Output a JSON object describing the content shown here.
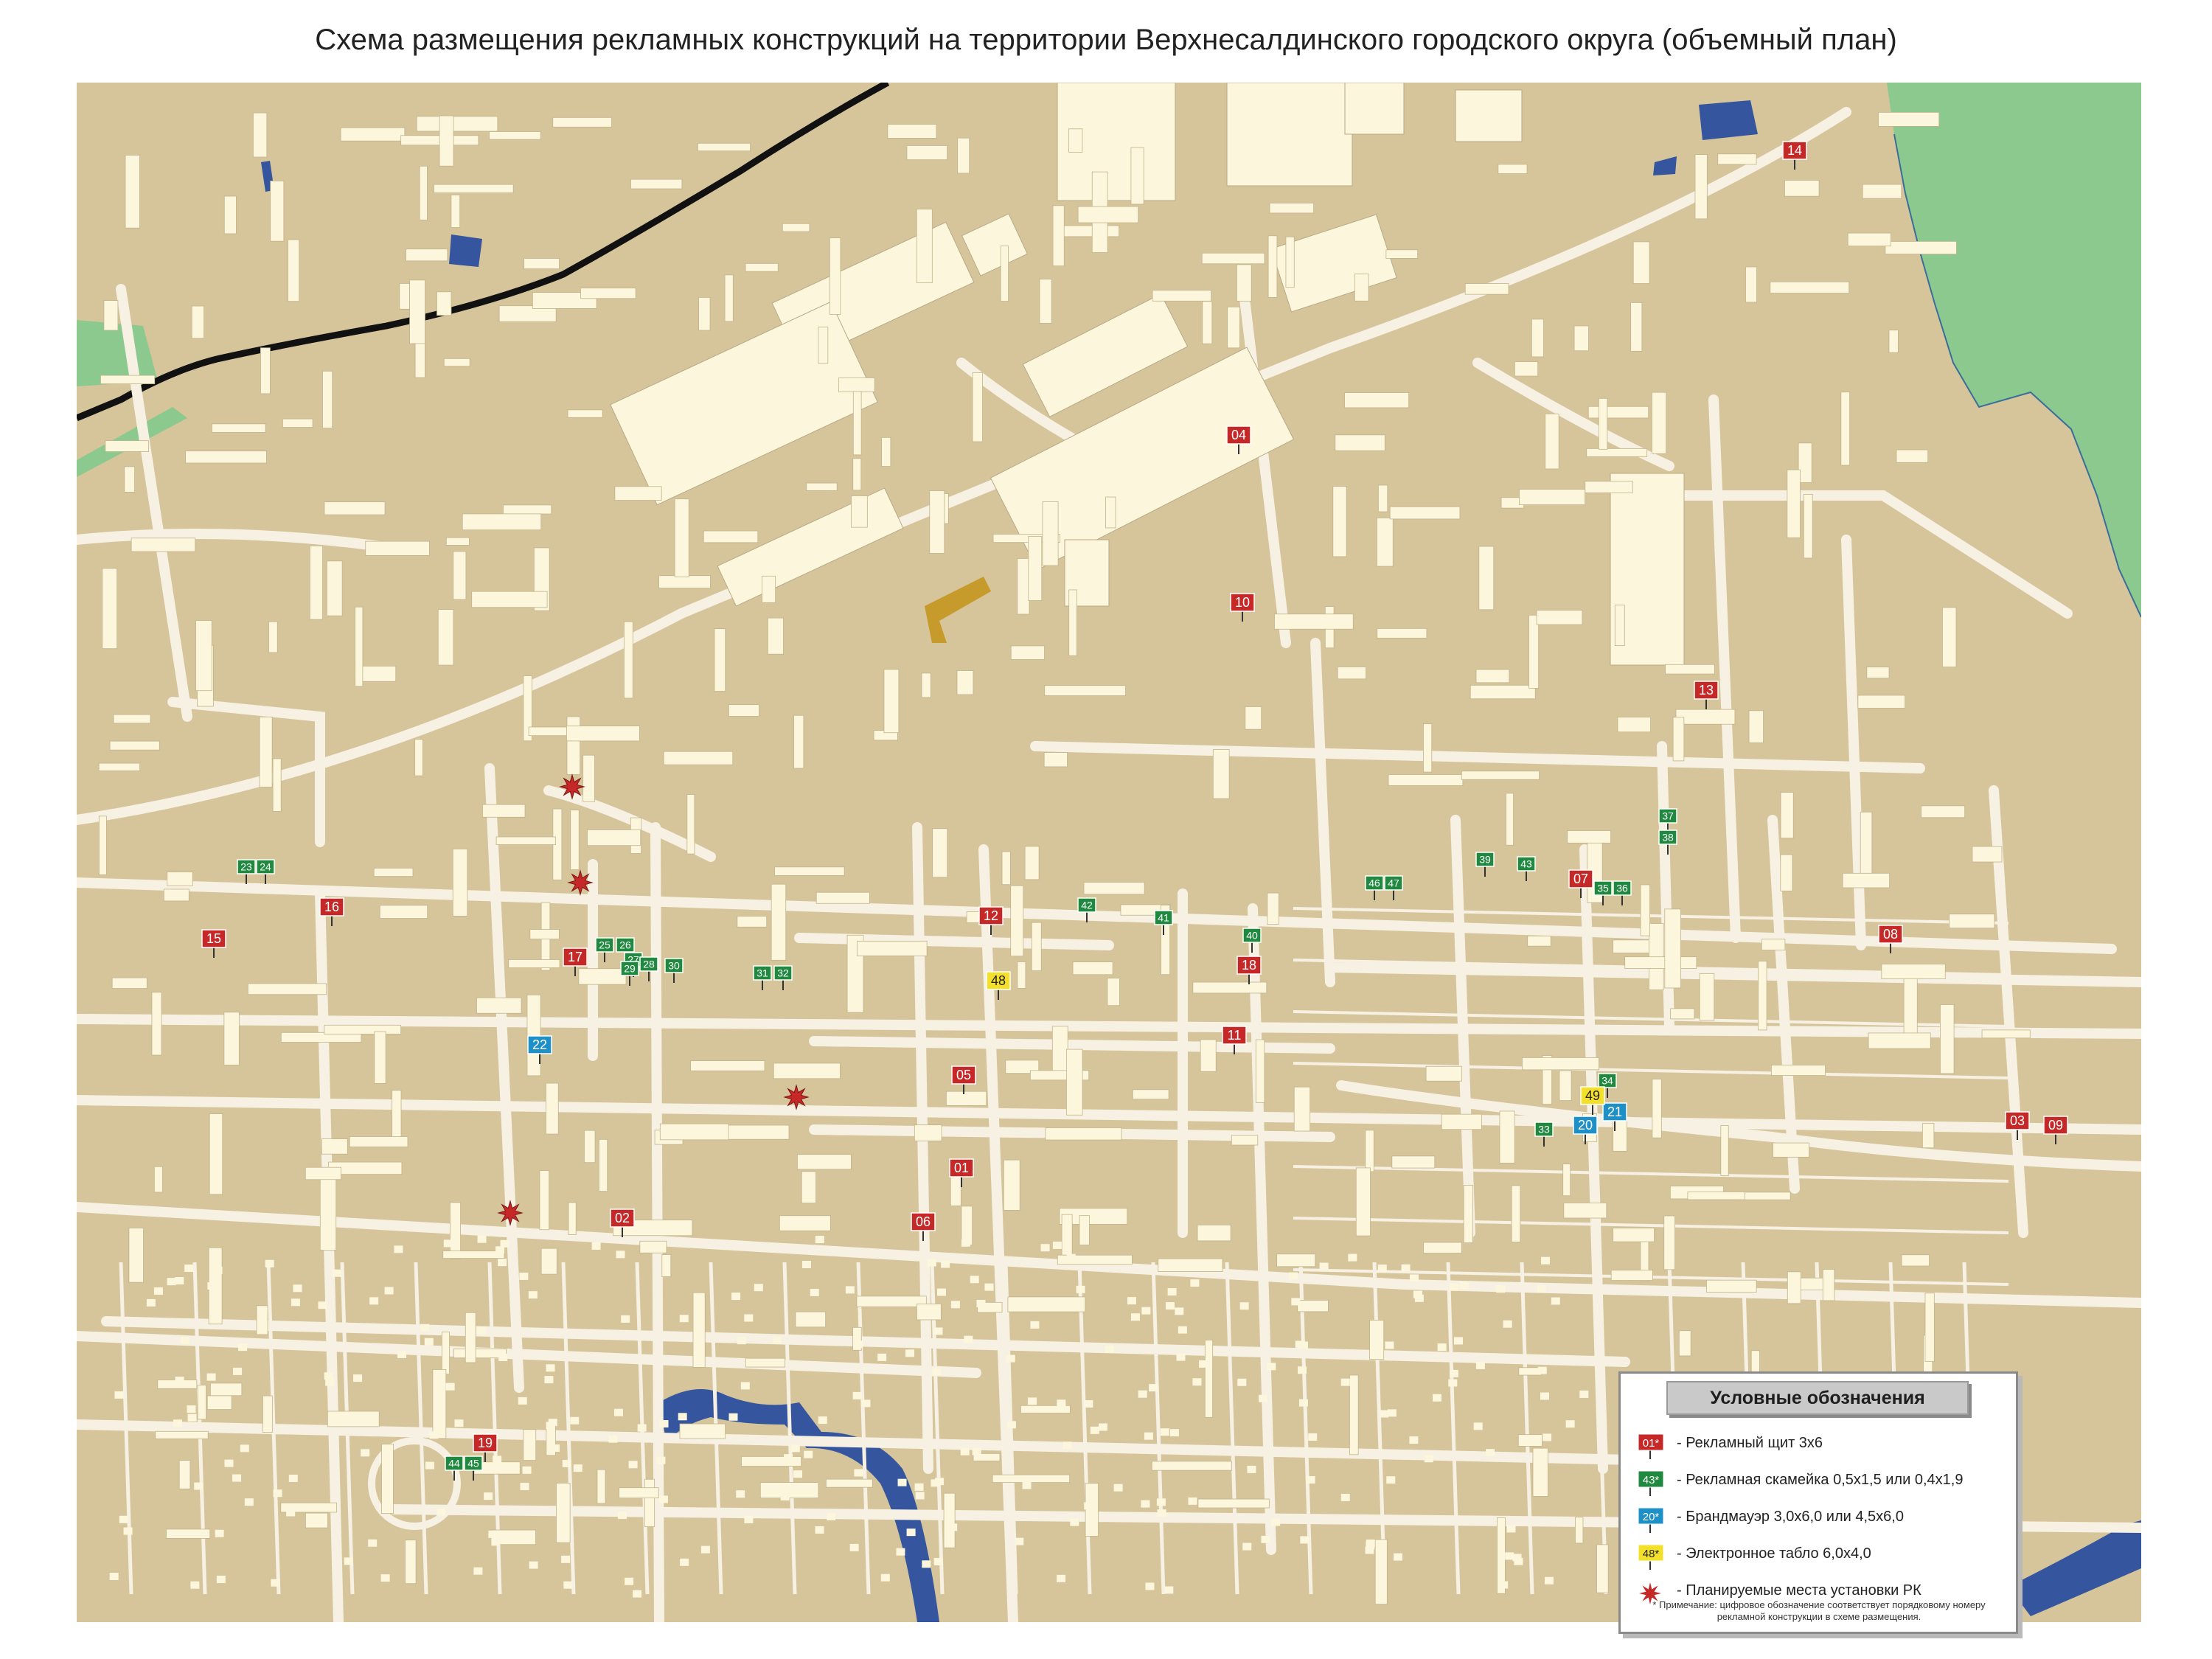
{
  "title": "Схема размещения рекламных конструкций на территории Верхнесалдинского городского округа (объемный план)",
  "colors": {
    "ground": "#d6c49b",
    "road": "#f6f1e2",
    "building": "#fbf6dc",
    "water": "#35569e",
    "forest": "#8bc98e",
    "railway": "#111111",
    "billboard": "#c62828",
    "bench": "#1f8a3f",
    "firewall": "#1e90c8",
    "display": "#f4e02a",
    "planned": "#c62828"
  },
  "legend": {
    "title": "Условные обозначения",
    "items": [
      {
        "type": "billboard",
        "symbol": "01*",
        "label": "- Рекламный щит 3х6"
      },
      {
        "type": "bench",
        "symbol": "43*",
        "label": "- Рекламная скамейка 0,5х1,5 или 0,4х1,9"
      },
      {
        "type": "firewall",
        "symbol": "20*",
        "label": "- Брандмауэр 3,0х6,0 или 4,5х6,0"
      },
      {
        "type": "display",
        "symbol": "48*",
        "label": "- Электронное табло 6,0х4,0"
      },
      {
        "type": "planned",
        "symbol": "",
        "label": "- Планируемые места установки РК"
      }
    ],
    "note": "* Примечание: цифровое обозначение соответствует порядковому номеру рекламной конструкции в схеме размещения."
  },
  "markers": [
    {
      "id": "01",
      "type": "billboard"
    },
    {
      "id": "02",
      "type": "billboard"
    },
    {
      "id": "03",
      "type": "billboard"
    },
    {
      "id": "04",
      "type": "billboard"
    },
    {
      "id": "05",
      "type": "billboard"
    },
    {
      "id": "06",
      "type": "billboard"
    },
    {
      "id": "07",
      "type": "billboard"
    },
    {
      "id": "08",
      "type": "billboard"
    },
    {
      "id": "09",
      "type": "billboard"
    },
    {
      "id": "10",
      "type": "billboard"
    },
    {
      "id": "11",
      "type": "billboard"
    },
    {
      "id": "12",
      "type": "billboard"
    },
    {
      "id": "13",
      "type": "billboard"
    },
    {
      "id": "14",
      "type": "billboard"
    },
    {
      "id": "15",
      "type": "billboard"
    },
    {
      "id": "16",
      "type": "billboard"
    },
    {
      "id": "17",
      "type": "billboard"
    },
    {
      "id": "18",
      "type": "billboard"
    },
    {
      "id": "19",
      "type": "billboard"
    },
    {
      "id": "20",
      "type": "firewall"
    },
    {
      "id": "21",
      "type": "firewall"
    },
    {
      "id": "22",
      "type": "firewall"
    },
    {
      "id": "23",
      "type": "bench"
    },
    {
      "id": "24",
      "type": "bench"
    },
    {
      "id": "25",
      "type": "bench"
    },
    {
      "id": "26",
      "type": "bench"
    },
    {
      "id": "27",
      "type": "bench"
    },
    {
      "id": "28",
      "type": "bench"
    },
    {
      "id": "29",
      "type": "bench"
    },
    {
      "id": "30",
      "type": "bench"
    },
    {
      "id": "31",
      "type": "bench"
    },
    {
      "id": "32",
      "type": "bench"
    },
    {
      "id": "33",
      "type": "bench"
    },
    {
      "id": "34",
      "type": "bench"
    },
    {
      "id": "35",
      "type": "bench"
    },
    {
      "id": "36",
      "type": "bench"
    },
    {
      "id": "37",
      "type": "bench"
    },
    {
      "id": "38",
      "type": "bench"
    },
    {
      "id": "39",
      "type": "bench"
    },
    {
      "id": "40",
      "type": "bench"
    },
    {
      "id": "41",
      "type": "bench"
    },
    {
      "id": "42",
      "type": "bench"
    },
    {
      "id": "43",
      "type": "bench"
    },
    {
      "id": "44",
      "type": "bench"
    },
    {
      "id": "45",
      "type": "bench"
    },
    {
      "id": "46",
      "type": "bench"
    },
    {
      "id": "47",
      "type": "bench"
    },
    {
      "id": "48",
      "type": "display"
    },
    {
      "id": "49",
      "type": "display"
    }
  ],
  "planned_count": 4
}
